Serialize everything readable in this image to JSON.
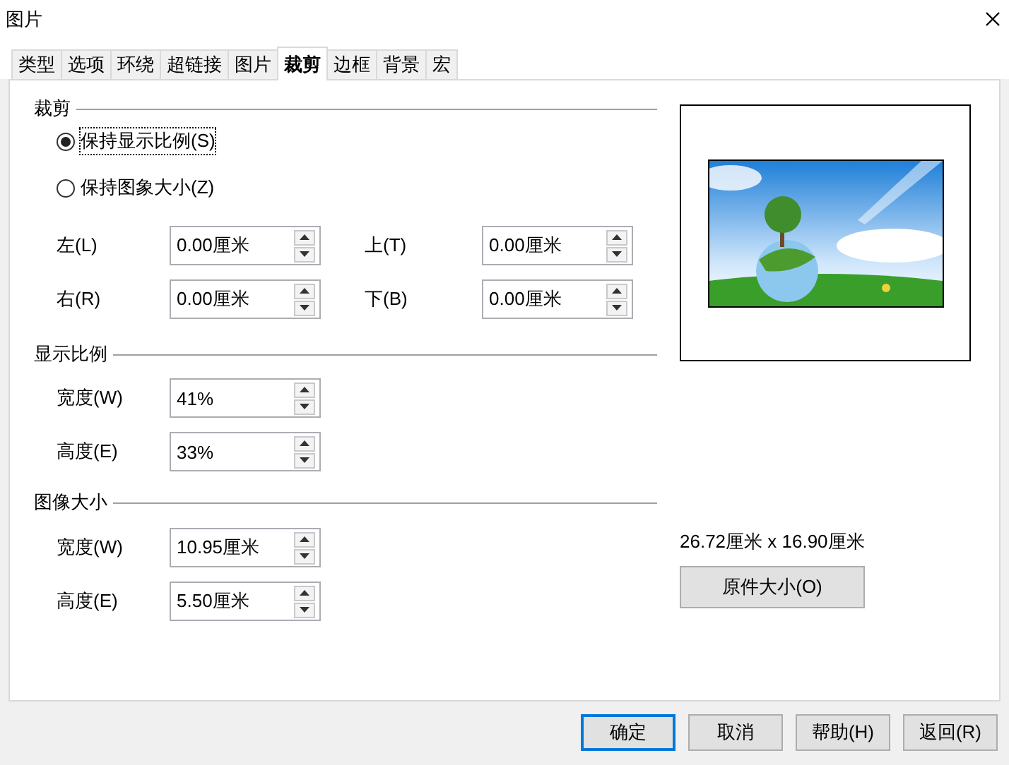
{
  "window": {
    "title": "图片"
  },
  "tabs": [
    {
      "label": "类型",
      "selected": false
    },
    {
      "label": "选项",
      "selected": false
    },
    {
      "label": "环绕",
      "selected": false
    },
    {
      "label": "超链接",
      "selected": false
    },
    {
      "label": "图片",
      "selected": false
    },
    {
      "label": "裁剪",
      "selected": true
    },
    {
      "label": "边框",
      "selected": false
    },
    {
      "label": "背景",
      "selected": false
    },
    {
      "label": "宏",
      "selected": false
    }
  ],
  "crop": {
    "heading": "裁剪",
    "options": [
      {
        "label": "保持显示比例(S)",
        "selected": true,
        "focused": true
      },
      {
        "label": "保持图象大小(Z)",
        "selected": false,
        "focused": false
      }
    ],
    "fields": [
      {
        "label": "左(L)",
        "value": "0.00厘米"
      },
      {
        "label": "上(T)",
        "value": "0.00厘米"
      },
      {
        "label": "右(R)",
        "value": "0.00厘米"
      },
      {
        "label": "下(B)",
        "value": "0.00厘米"
      }
    ]
  },
  "scale": {
    "heading": "显示比例",
    "fields": [
      {
        "label": "宽度(W)",
        "value": "41%"
      },
      {
        "label": "高度(E)",
        "value": "33%"
      }
    ]
  },
  "image_size": {
    "heading": "图像大小",
    "fields": [
      {
        "label": "宽度(W)",
        "value": "10.95厘米"
      },
      {
        "label": "高度(E)",
        "value": "5.50厘米"
      }
    ]
  },
  "original_size": {
    "text": "26.72厘米 x 16.90厘米",
    "button": "原件大小(O)"
  },
  "buttons": [
    {
      "label": "确定",
      "default": true
    },
    {
      "label": "取消",
      "default": false
    },
    {
      "label": "帮助(H)",
      "default": false
    },
    {
      "label": "返回(R)",
      "default": false
    }
  ]
}
